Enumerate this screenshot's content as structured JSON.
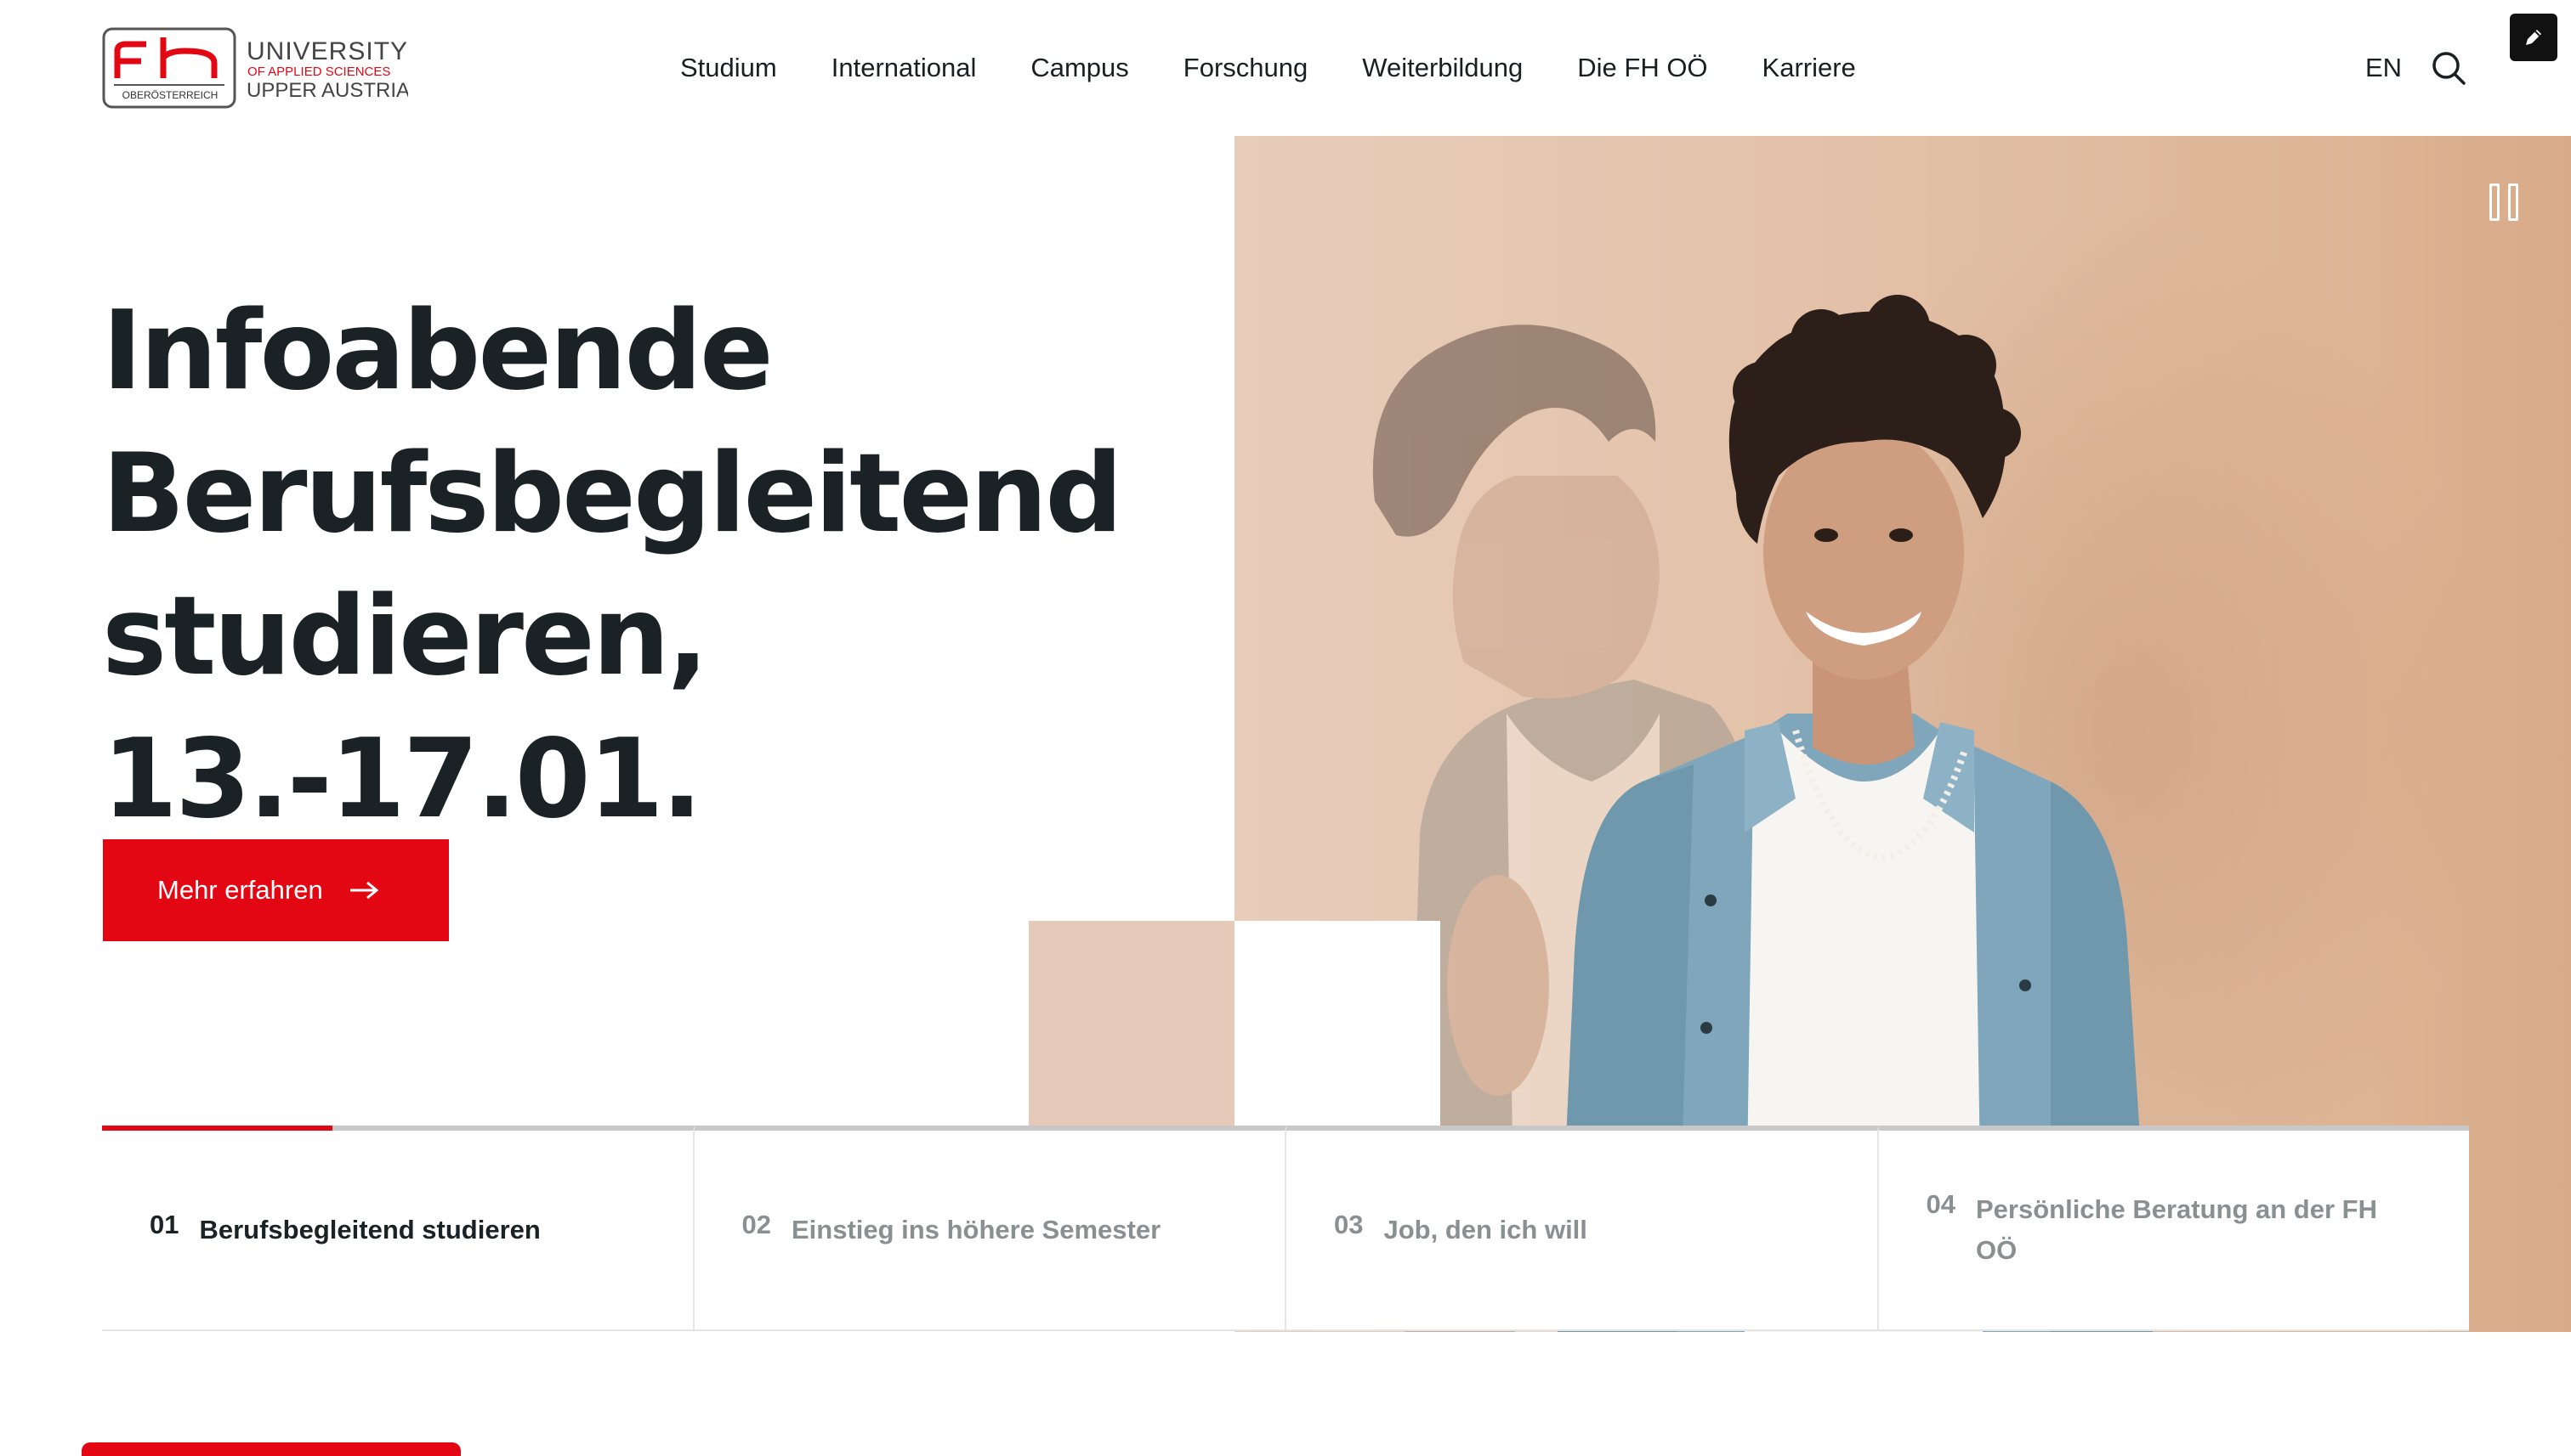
{
  "brand": {
    "logo_mark": "fh",
    "logo_sub": "OBERÖSTERREICH",
    "logo_line1": "UNIVERSITY",
    "logo_line2": "OF APPLIED SCIENCES",
    "logo_line3": "UPPER AUSTRIA",
    "accent": "#e30613"
  },
  "nav": {
    "items": [
      "Studium",
      "International",
      "Campus",
      "Forschung",
      "Weiterbildung",
      "Die FH OÖ",
      "Karriere"
    ],
    "lang": "EN",
    "search_icon": "search-icon",
    "edit_icon": "pencil-icon"
  },
  "hero": {
    "headline_line1": "Infoabende",
    "headline_line2": "Berufsbegleitend",
    "headline_line3": "studieren, 13.-17.01.",
    "cta_label": "Mehr erfahren",
    "cta_icon": "arrow-right-icon",
    "pause_icon": "pause-icon",
    "photo_bg": "#e3c1a8"
  },
  "tabs": [
    {
      "num": "01",
      "label": "Berufsbegleitend studieren",
      "active": true,
      "progress": 0.39
    },
    {
      "num": "02",
      "label": "Einstieg ins höhere Semester",
      "active": false
    },
    {
      "num": "03",
      "label": "Job, den ich will",
      "active": false
    },
    {
      "num": "04",
      "label": "Persönliche Beratung an der FH OÖ",
      "active": false
    }
  ]
}
